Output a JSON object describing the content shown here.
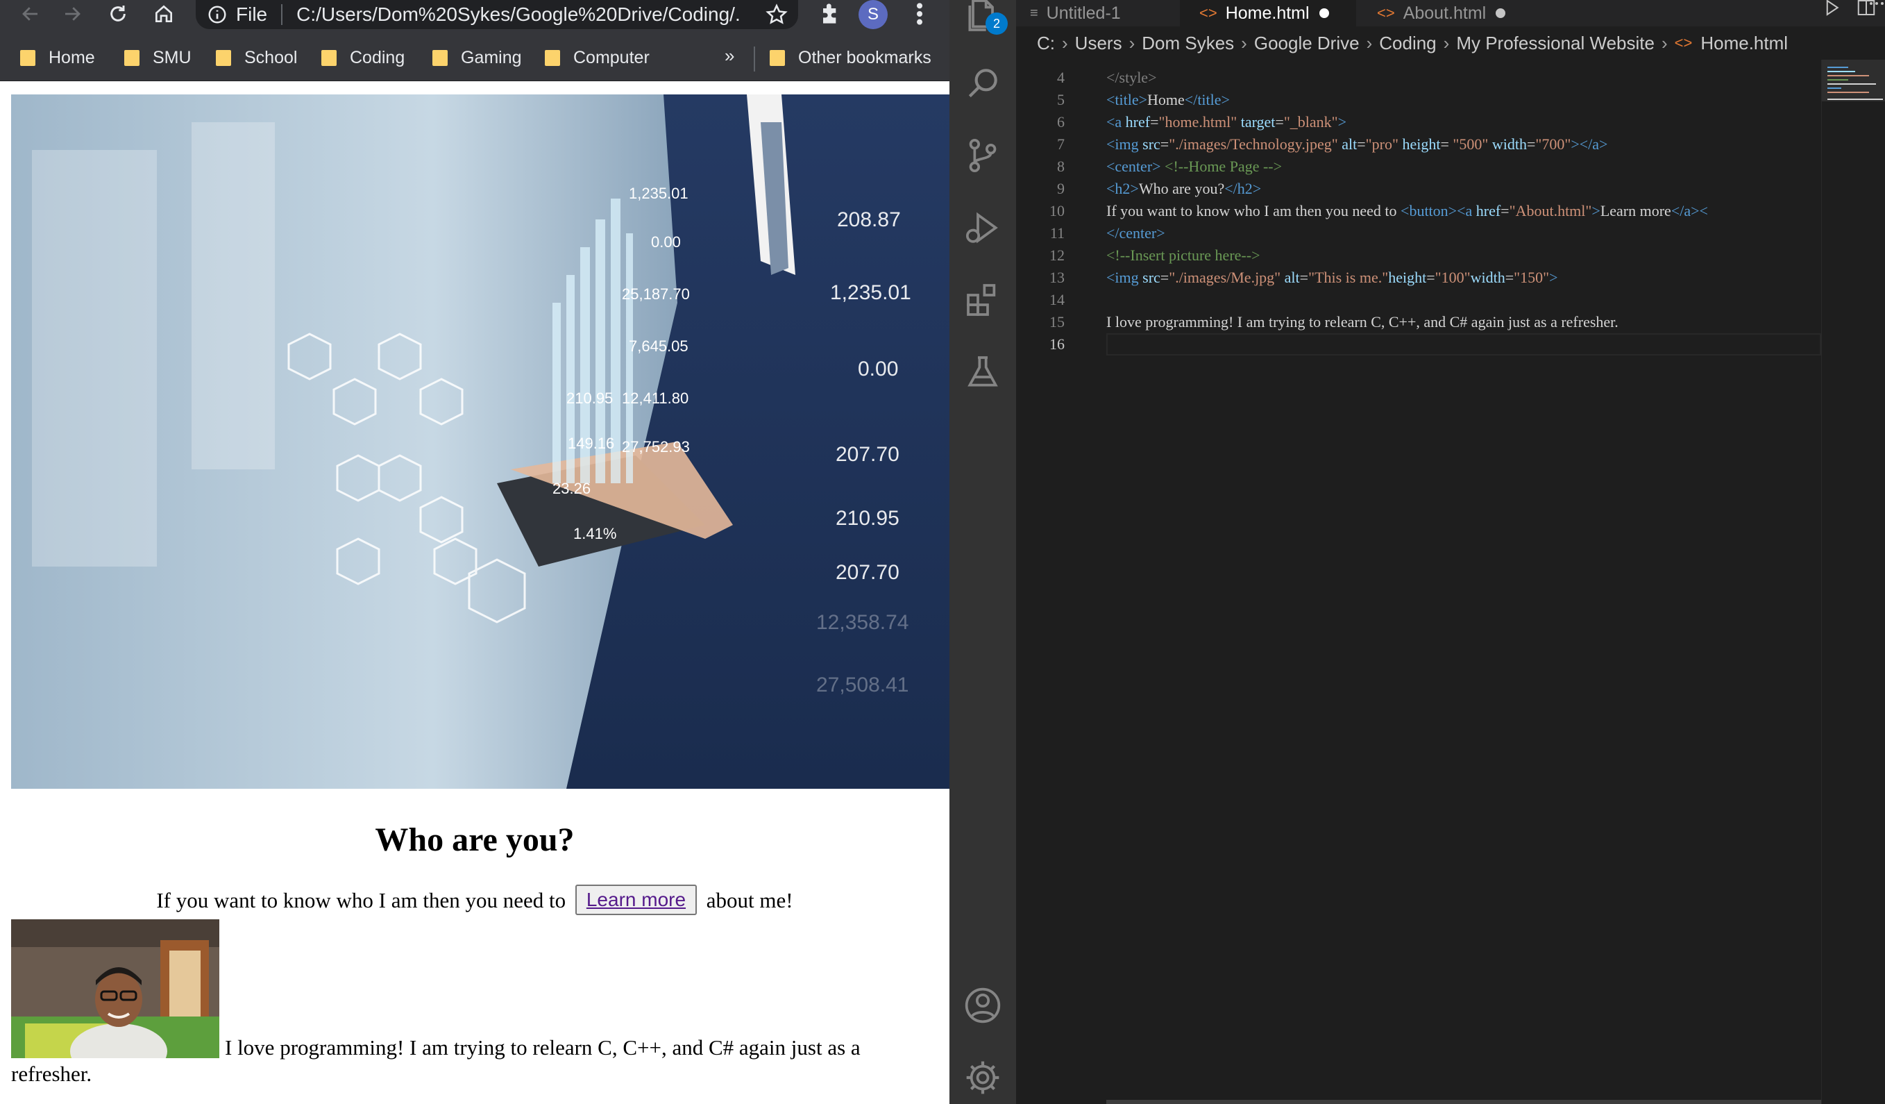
{
  "browser": {
    "omnibox": {
      "scheme_label": "File",
      "url": "C:/Users/Dom%20Sykes/Google%20Drive/Coding/..."
    },
    "profile_initial": "S",
    "bookmarks": [
      {
        "label": "Home"
      },
      {
        "label": "SMU"
      },
      {
        "label": "School"
      },
      {
        "label": "Coding"
      },
      {
        "label": "Gaming"
      },
      {
        "label": "Computer"
      }
    ],
    "bookmarks_overflow": "»",
    "other_bookmarks": "Other bookmarks",
    "page": {
      "hero_numbers": [
        "1,235.01",
        "0.00",
        "25,187.70",
        "7,645.05",
        "12,411.80",
        "27,752.93",
        "210.95",
        "149.16",
        "23.26",
        "1.41%",
        "208.87",
        "1,235.01",
        "0.00",
        "207.70",
        "210.95",
        "207.70",
        "12,358.74",
        "27,508.41"
      ],
      "heading": "Who are you?",
      "intro_before": "If you want to know who I am then you need to",
      "learn_more": "Learn more",
      "intro_after": "about me!",
      "paragraph": "I love programming! I am trying to relearn C, C++, and C# again just as a refresher."
    }
  },
  "vscode": {
    "explorer_badge": "2",
    "tabs": [
      {
        "label": "Untitled-1",
        "active": false,
        "dirty": false
      },
      {
        "label": "Home.html",
        "active": true,
        "dirty": true
      },
      {
        "label": "About.html",
        "active": false,
        "dirty": true
      }
    ],
    "breadcrumb": [
      "C:",
      "Users",
      "Dom Sykes",
      "Google Drive",
      "Coding",
      "My Professional Website",
      "Home.html"
    ],
    "line_numbers": [
      "4",
      "5",
      "6",
      "7",
      "8",
      "9",
      "10",
      "11",
      "12",
      "13",
      "14",
      "15",
      "16"
    ],
    "code": {
      "l4": {
        "tag": "</style>"
      },
      "l5": {
        "open": "<title>",
        "text": "Home",
        "close": "</title>"
      },
      "l6": {
        "open": "<a",
        "a1": "href",
        "v1": "\"home.html\"",
        "a2": "target",
        "v2": "\"_blank\"",
        "end": ">"
      },
      "l7": {
        "open": "<img",
        "a1": "src",
        "v1": "\"./images/Technology.jpeg\"",
        "a2": "alt",
        "v2": "\"pro\"",
        "a3": "height",
        "v3": " \"500\"",
        "a4": "width",
        "v4": "\"700\"",
        "end": "></a>"
      },
      "l8": {
        "tag": "<center>",
        "comment": "<!--Home Page -->"
      },
      "l9": {
        "open": "<h2>",
        "text": "Who are you?",
        "close": "</h2>"
      },
      "l10": {
        "text": "If you want to know who I am then you need to ",
        "t1": "<button>",
        "t2": "<a",
        "a1": "href",
        "v1": "\"About.html\"",
        "t3": ">",
        "text2": "Learn more",
        "t4": "</a><"
      },
      "l11": {
        "tag": "</center>"
      },
      "l12": {
        "comment": "<!--Insert picture here-->"
      },
      "l13": {
        "open": "<img",
        "a1": "src",
        "v1": "\"./images/Me.jpg\"",
        "a2": "alt",
        "v2": "\"This is me.\"",
        "a3": "height",
        "v3": "\"100\"",
        "a4": "width",
        "v4": "\"150\"",
        "end": ">"
      },
      "l15": {
        "text": "I love programming! I am trying to relearn C, C++, and C# again just as a refresher."
      }
    }
  },
  "colors": {
    "vscode_bg": "#1e1e1e",
    "tag": "#569cd6",
    "attr": "#9cdcfe",
    "string": "#ce9178",
    "comment": "#6a9955",
    "link_visited": "#551a8b"
  }
}
